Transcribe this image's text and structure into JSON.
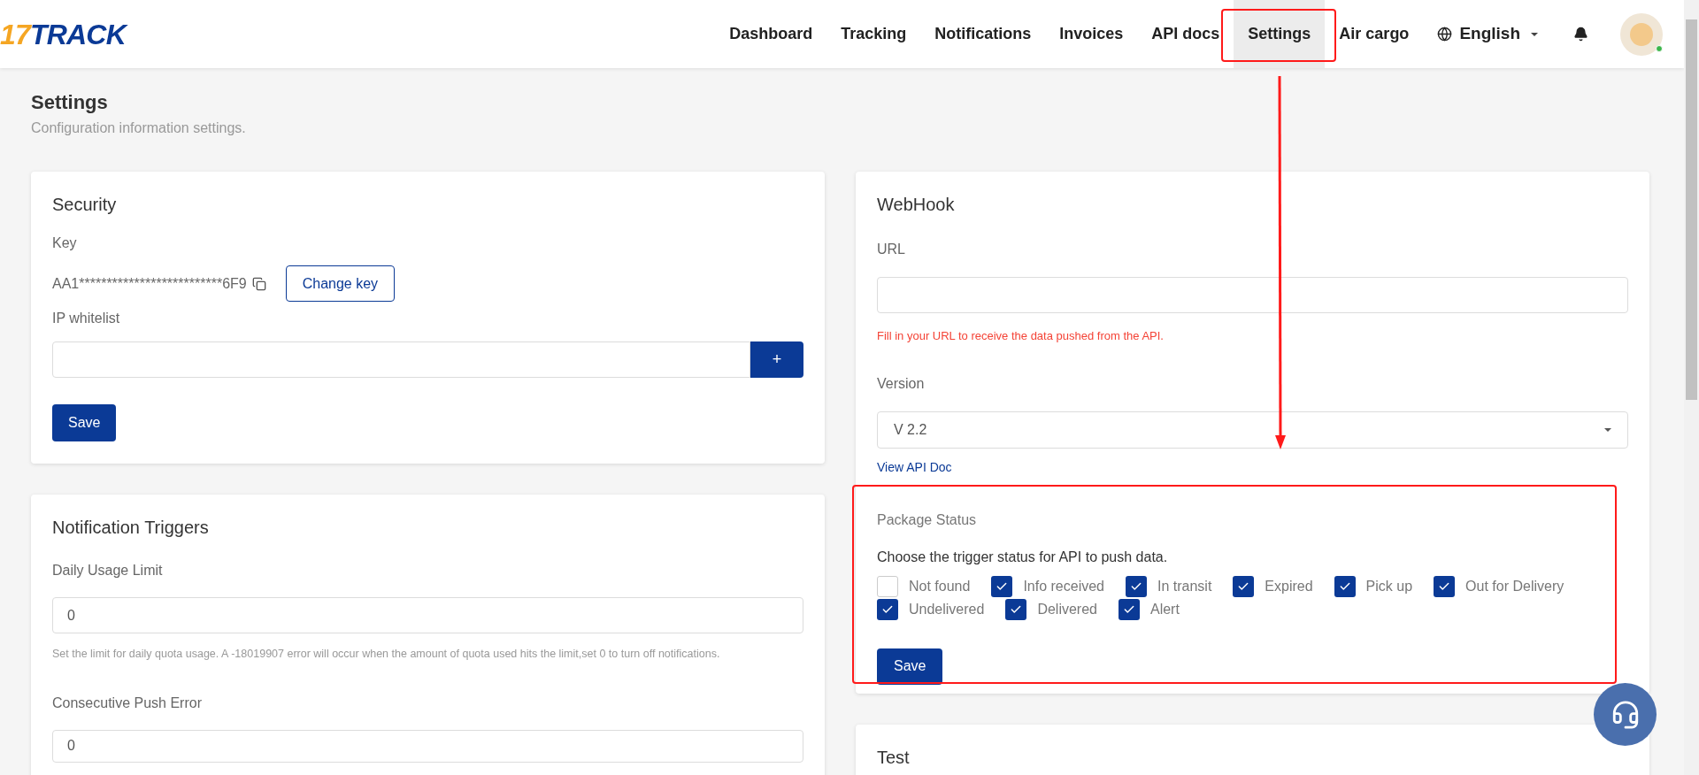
{
  "header": {
    "logo": {
      "digits": "17",
      "word": "TRACK"
    },
    "nav": [
      {
        "label": "Dashboard",
        "selected": false
      },
      {
        "label": "Tracking",
        "selected": false
      },
      {
        "label": "Notifications",
        "selected": false
      },
      {
        "label": "Invoices",
        "selected": false
      },
      {
        "label": "API docs",
        "selected": false
      },
      {
        "label": "Settings",
        "selected": true
      },
      {
        "label": "Air cargo",
        "selected": false
      }
    ],
    "language": "English"
  },
  "page": {
    "title": "Settings",
    "subtitle": "Configuration information settings."
  },
  "security": {
    "title": "Security",
    "key_label": "Key",
    "key_value": "AA1**************************6F9",
    "change_key": "Change key",
    "ip_label": "IP whitelist",
    "add_button": "+",
    "save": "Save"
  },
  "notification_triggers": {
    "title": "Notification Triggers",
    "daily_label": "Daily Usage Limit",
    "daily_value": "0",
    "daily_hint": "Set the limit for daily quota usage. A -18019907 error will occur when the amount of quota used hits the limit,set 0 to turn off notifications.",
    "push_label": "Consecutive Push Error",
    "push_value": "0"
  },
  "webhook": {
    "title": "WebHook",
    "url_label": "URL",
    "url_hint": "Fill in your URL to receive the data pushed from the API.",
    "version_label": "Version",
    "version_value": "V 2.2",
    "doc_link": "View API Doc",
    "status_title": "Package Status",
    "status_prompt": "Choose the trigger status for API to push data.",
    "statuses": [
      {
        "label": "Not found",
        "checked": false
      },
      {
        "label": "Info received",
        "checked": true
      },
      {
        "label": "In transit",
        "checked": true
      },
      {
        "label": "Expired",
        "checked": true
      },
      {
        "label": "Pick up",
        "checked": true
      },
      {
        "label": "Out for Delivery",
        "checked": true
      },
      {
        "label": "Undelivered",
        "checked": true
      },
      {
        "label": "Delivered",
        "checked": true
      },
      {
        "label": "Alert",
        "checked": true
      }
    ],
    "save": "Save"
  },
  "test": {
    "title": "Test"
  }
}
